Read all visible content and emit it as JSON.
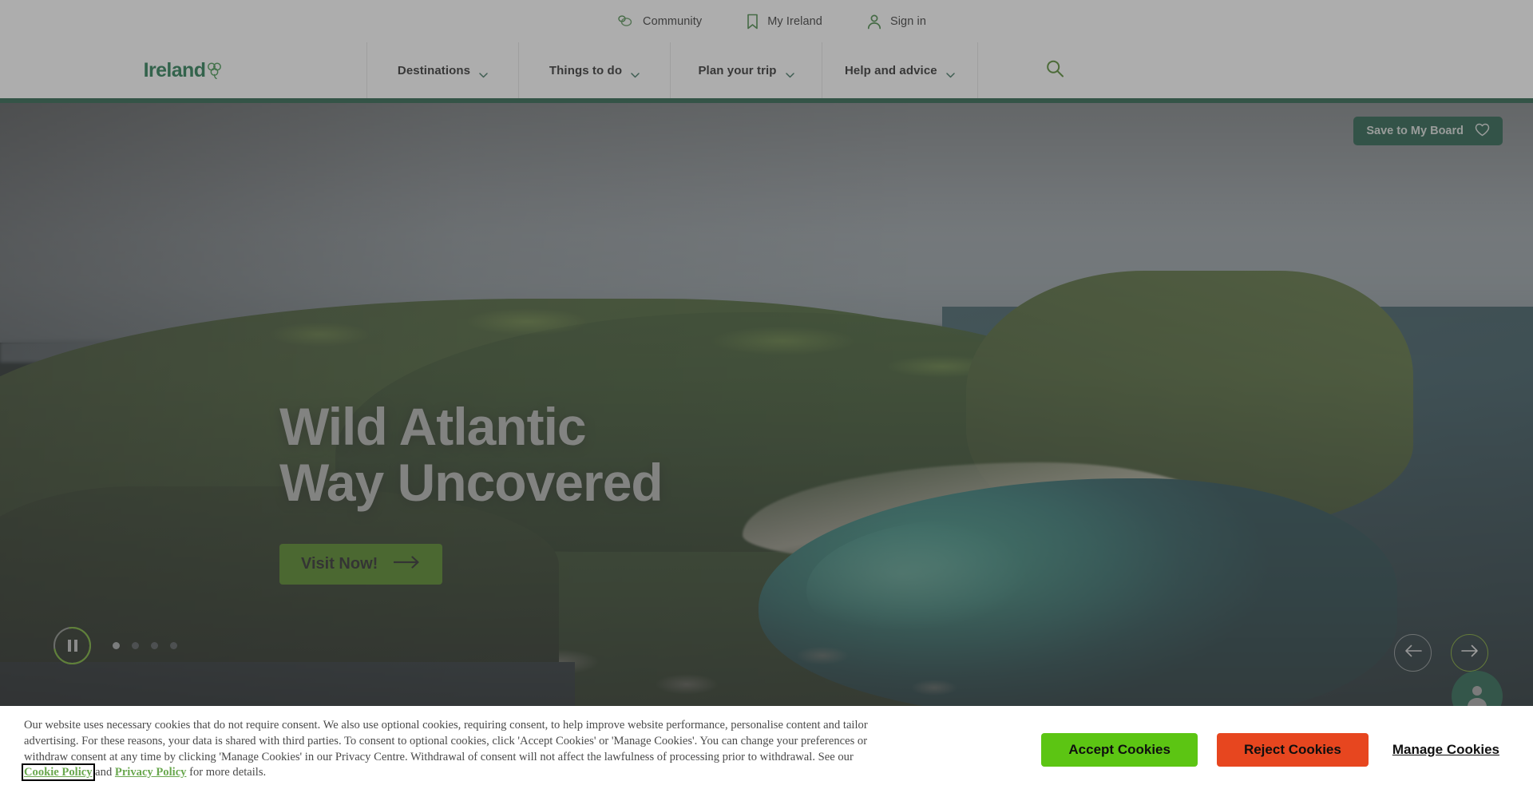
{
  "utility_bar": {
    "items": [
      {
        "label": "Community",
        "icon": "chat-bubble-icon"
      },
      {
        "label": "My Ireland",
        "icon": "bookmark-icon"
      },
      {
        "label": "Sign in",
        "icon": "user-icon"
      }
    ]
  },
  "main_nav": {
    "logo": "Ireland",
    "logo_icon": "shamrock-icon",
    "items": [
      {
        "label": "Destinations"
      },
      {
        "label": "Things to do"
      },
      {
        "label": "Plan your trip"
      },
      {
        "label": "Help and advice"
      }
    ],
    "search_icon": "search-icon"
  },
  "hero": {
    "save_button": {
      "label": "Save to My Board",
      "icon": "heart-icon"
    },
    "title": "Wild Atlantic\nWay Uncovered",
    "cta": {
      "label": "Visit Now!",
      "icon": "arrow-right-icon"
    },
    "carousel": {
      "play_state": "pause",
      "slide_count": 4,
      "active_slide": 1,
      "prev_icon": "arrow-left-icon",
      "next_icon": "arrow-right-icon"
    },
    "chat_widget_icon": "person-support-icon"
  },
  "cookie_banner": {
    "body_part1": "Our website uses necessary cookies that do not require consent. We also use optional cookies, requiring consent, to help improve website performance, personalise content and tailor advertising. For these reasons, your data is shared with third parties. To consent to optional cookies, click 'Accept Cookies' or 'Manage Cookies'. You can change your preferences or withdraw consent at any time by clicking 'Manage Cookies' in our Privacy Centre. Withdrawal of consent will not affect the lawfulness of processing prior to withdrawal. See our ",
    "link_cookie_policy": "Cookie Policy",
    "body_mid": " and ",
    "link_privacy_policy": "Privacy Policy",
    "body_end": " for more details.",
    "accept_label": "Accept Cookies",
    "reject_label": "Reject Cookies",
    "manage_label": "Manage Cookies"
  },
  "colors": {
    "brand_green": "#0a6b3d",
    "dark_green": "#0b4a35",
    "cta_green": "#3b7406",
    "accept_green": "#5cc513",
    "reject_red": "#e7461f",
    "accent_lime": "#63a615"
  }
}
